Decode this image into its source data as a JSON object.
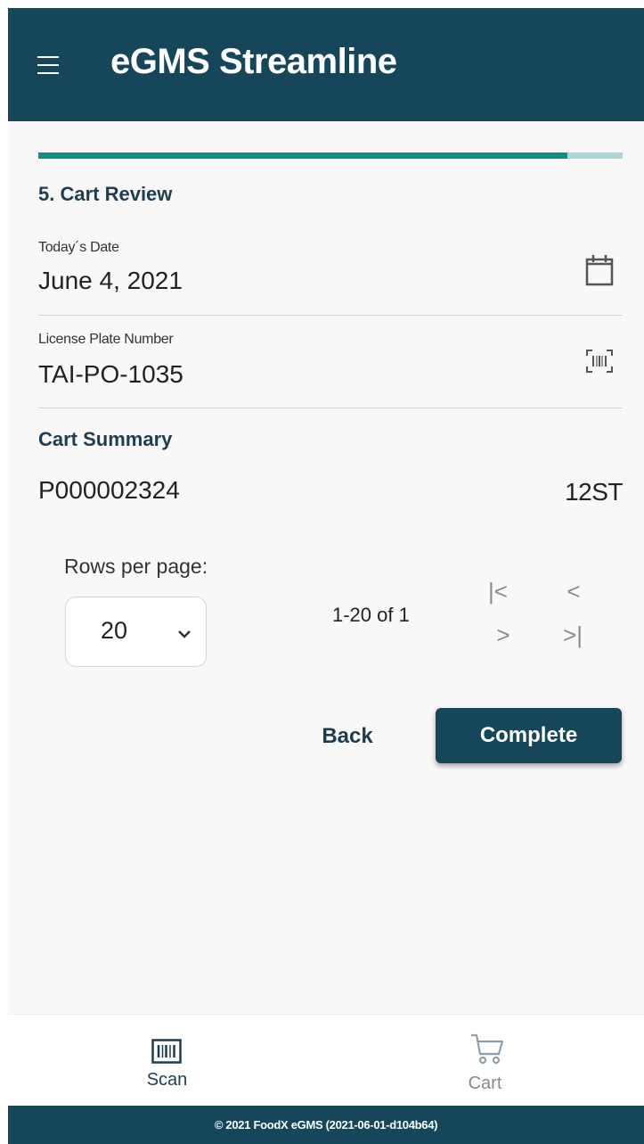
{
  "header": {
    "title": "eGMS Streamline",
    "menu_icon": "hamburger-menu-icon"
  },
  "progress": {
    "percent": 90.5
  },
  "step": {
    "title": "5. Cart Review"
  },
  "fields": {
    "date": {
      "label": "Today´s Date",
      "value": "June 4, 2021",
      "icon": "calendar-icon"
    },
    "plate": {
      "label": "License Plate Number",
      "value": "TAI-PO-1035",
      "icon": "barcode-scan-icon"
    }
  },
  "cart_summary": {
    "title": "Cart Summary",
    "items": [
      {
        "id": "P000002324",
        "qty": "12ST"
      }
    ]
  },
  "pagination": {
    "rows_label": "Rows per page:",
    "rows_value": "20",
    "page_info": "1-20 of 1",
    "buttons": {
      "first": "|<",
      "prev": "<",
      "next": ">",
      "last": ">|"
    }
  },
  "actions": {
    "back": "Back",
    "complete": "Complete"
  },
  "bottom_nav": {
    "items": [
      {
        "label": "Scan",
        "icon": "barcode-icon",
        "active": true
      },
      {
        "label": "Cart",
        "icon": "cart-icon",
        "active": false
      }
    ]
  },
  "footer": {
    "text": "© 2021 FoodX eGMS (2021-06-01-d104b64)"
  },
  "colors": {
    "primary": "#16465a",
    "accent": "#0d8e86",
    "accent_light": "#a9d8d6",
    "background": "#f8f8f8"
  }
}
